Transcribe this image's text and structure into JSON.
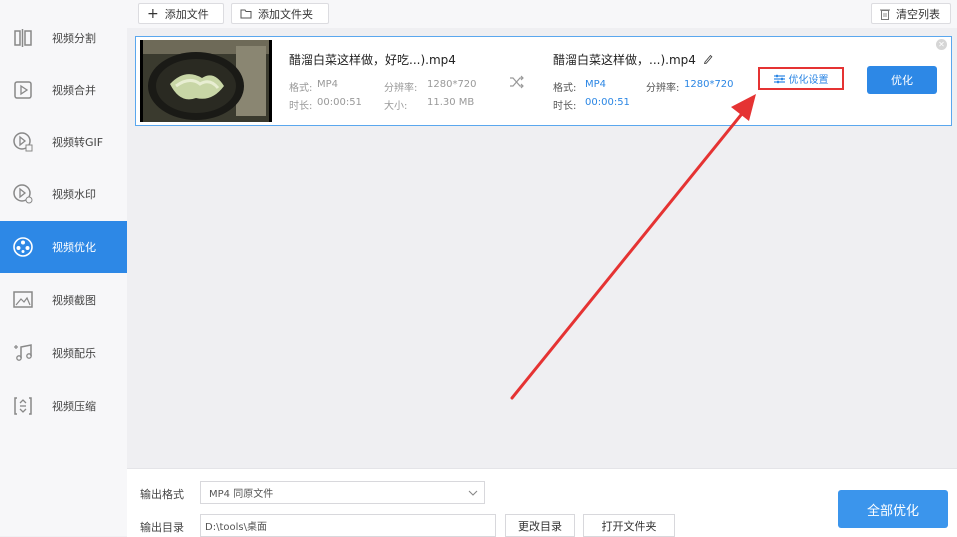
{
  "sidebar": {
    "items": [
      {
        "label": "视频分割",
        "icon": "split-icon"
      },
      {
        "label": "视频合并",
        "icon": "merge-icon"
      },
      {
        "label": "视频转GIF",
        "icon": "gif-icon"
      },
      {
        "label": "视频水印",
        "icon": "watermark-icon"
      },
      {
        "label": "视频优化",
        "icon": "optimize-icon",
        "active": true
      },
      {
        "label": "视频截图",
        "icon": "screenshot-icon"
      },
      {
        "label": "视频配乐",
        "icon": "music-icon"
      },
      {
        "label": "视频压缩",
        "icon": "compress-icon"
      }
    ]
  },
  "toolbar": {
    "add_file": "添加文件",
    "add_folder": "添加文件夹",
    "clear_list": "清空列表"
  },
  "file": {
    "source": {
      "name": "醋溜白菜这样做，好吃...).mp4",
      "format_label": "格式:",
      "format": "MP4",
      "resolution_label": "分辨率:",
      "resolution": "1280*720",
      "duration_label": "时长:",
      "duration": "00:00:51",
      "size_label": "大小:",
      "size": "11.30 MB"
    },
    "output": {
      "name": "醋溜白菜这样做，...).mp4",
      "format_label": "格式:",
      "format": "MP4",
      "resolution_label": "分辨率:",
      "resolution": "1280*720",
      "duration_label": "时长:",
      "duration": "00:00:51"
    },
    "settings_label": "优化设置",
    "optimize_label": "优化"
  },
  "bottom": {
    "format_label": "输出格式",
    "format_value": "MP4  同原文件",
    "dir_label": "输出目录",
    "dir_value": "D:\\tools\\桌面",
    "change_dir": "更改目录",
    "open_folder": "打开文件夹",
    "optimize_all": "全部优化"
  },
  "colors": {
    "accent": "#2d88e6",
    "highlight": "#e53333"
  }
}
